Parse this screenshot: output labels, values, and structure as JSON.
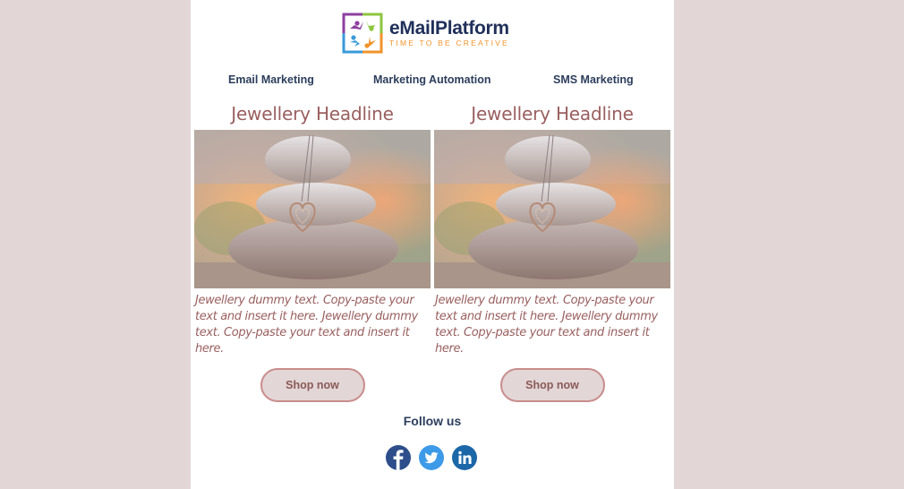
{
  "brand": {
    "name": "eMailPlatform",
    "tagline": "TIME TO BE CREATIVE",
    "logo_icon": "people-circle-logo-icon",
    "colors": {
      "purple": "#8e3fa0",
      "green": "#8cc63f",
      "blue": "#3a9ad9",
      "orange": "#f0932b",
      "navy": "#1f2f5a"
    }
  },
  "nav": {
    "items": [
      {
        "label": "Email Marketing"
      },
      {
        "label": "Marketing Automation"
      },
      {
        "label": "SMS Marketing"
      }
    ]
  },
  "products": [
    {
      "headline": "Jewellery Headline",
      "image_alt": "Heart pendant necklace resting on stacked stones",
      "description": "Jewellery dummy text. Copy-paste your text and insert it here. Jewellery dummy text. Copy-paste your text and insert it here.",
      "button_label": "Shop now"
    },
    {
      "headline": "Jewellery Headline",
      "image_alt": "Heart pendant necklace resting on stacked stones",
      "description": "Jewellery dummy text. Copy-paste your text and insert it here. Jewellery dummy text. Copy-paste your text and insert it here.",
      "button_label": "Shop now"
    }
  ],
  "footer": {
    "follow_label": "Follow us",
    "social": [
      {
        "name": "facebook",
        "icon": "facebook-icon",
        "color": "#2d4d8b"
      },
      {
        "name": "twitter",
        "icon": "twitter-icon",
        "color": "#3d9ae8"
      },
      {
        "name": "linkedin",
        "icon": "linkedin-icon",
        "color": "#1b67a8"
      }
    ]
  },
  "theme": {
    "page_background": "#e3d6d6",
    "accent_text": "#9a5f5f",
    "button_border": "#c98c8c",
    "nav_text": "#2c3e5c"
  }
}
